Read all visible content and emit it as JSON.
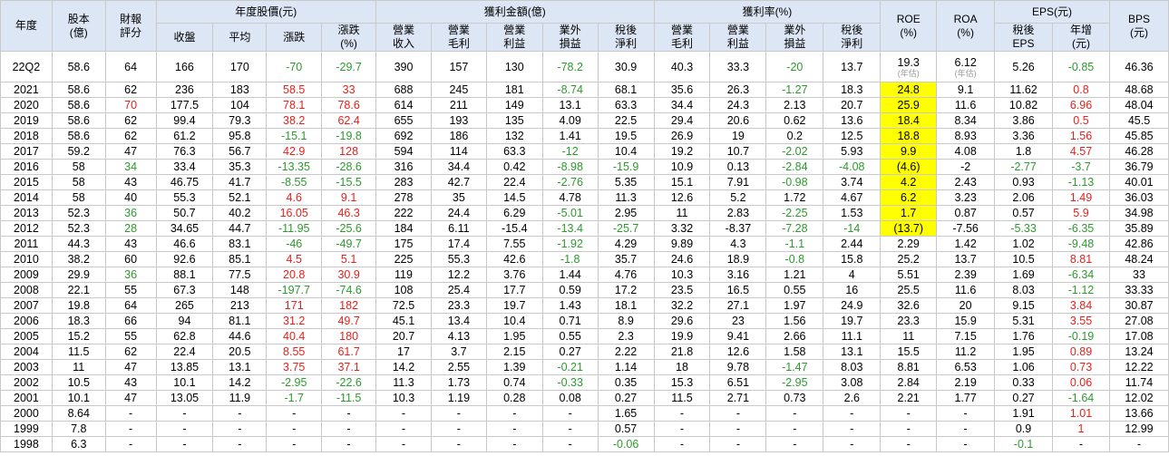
{
  "colors": {
    "header_bg": "#dce6f4",
    "border": "#c9c9c9",
    "positive": "#e8201a",
    "negative": "#2d9a2d",
    "highlight": "#ffff00"
  },
  "headers": {
    "year": "年度",
    "capital": "股本\n(億)",
    "rating": "財報\n評分",
    "price_group": "年度股價(元)",
    "price_close": "收盤",
    "price_avg": "平均",
    "price_chg": "漲跌",
    "price_chg_pct": "漲跌\n(%)",
    "amount_group": "獲利金額(億)",
    "amt_rev": "營業\n收入",
    "amt_gross": "營業\n毛利",
    "amt_op": "營業\n利益",
    "amt_nonop": "業外\n損益",
    "amt_net": "稅後\n淨利",
    "margin_group": "獲利率(%)",
    "mg_gross": "營業\n毛利",
    "mg_op": "營業\n利益",
    "mg_nonop": "業外\n損益",
    "mg_net": "稅後\n淨利",
    "roe": "ROE\n(%)",
    "roa": "ROA\n(%)",
    "eps_group": "EPS(元)",
    "eps": "稅後\nEPS",
    "eps_yoy": "年增\n(元)",
    "bps": "BPS\n(元)"
  },
  "rows": [
    {
      "year": "22Q2",
      "capital": "58.6",
      "rating": "64",
      "close": "166",
      "avg": "170",
      "chg": "-70",
      "chg_pct": "-29.7",
      "rev": "390",
      "gross": "157",
      "op": "130",
      "nonop": "-78.2",
      "net": "30.9",
      "mg_gross": "40.3",
      "mg_op": "33.3",
      "mg_nonop": "-20",
      "mg_net": "13.7",
      "roe": "19.3",
      "roe_note": "(年估)",
      "roa": "6.12",
      "roa_note": "(年估)",
      "eps": "5.26",
      "eps_yoy": "-0.85",
      "bps": "46.36"
    },
    {
      "year": "2021",
      "capital": "58.6",
      "rating": "62",
      "close": "236",
      "avg": "183",
      "chg": "58.5",
      "chg_pct": "33",
      "rev": "688",
      "gross": "245",
      "op": "181",
      "nonop": "-8.74",
      "net": "68.1",
      "mg_gross": "35.6",
      "mg_op": "26.3",
      "mg_nonop": "-1.27",
      "mg_net": "18.3",
      "roe": "24.8",
      "roa": "9.1",
      "eps": "11.62",
      "eps_yoy": "0.8",
      "bps": "48.68"
    },
    {
      "year": "2020",
      "capital": "58.6",
      "rating": "70",
      "close": "177.5",
      "avg": "104",
      "chg": "78.1",
      "chg_pct": "78.6",
      "rev": "614",
      "gross": "211",
      "op": "149",
      "nonop": "13.1",
      "net": "63.3",
      "mg_gross": "34.4",
      "mg_op": "24.3",
      "mg_nonop": "2.13",
      "mg_net": "20.7",
      "roe": "25.9",
      "roa": "11.6",
      "eps": "10.82",
      "eps_yoy": "6.96",
      "bps": "48.04"
    },
    {
      "year": "2019",
      "capital": "58.6",
      "rating": "62",
      "close": "99.4",
      "avg": "79.3",
      "chg": "38.2",
      "chg_pct": "62.4",
      "rev": "655",
      "gross": "193",
      "op": "135",
      "nonop": "4.09",
      "net": "22.5",
      "mg_gross": "29.4",
      "mg_op": "20.6",
      "mg_nonop": "0.62",
      "mg_net": "13.6",
      "roe": "18.4",
      "roa": "8.34",
      "eps": "3.86",
      "eps_yoy": "0.5",
      "bps": "45.5"
    },
    {
      "year": "2018",
      "capital": "58.6",
      "rating": "62",
      "close": "61.2",
      "avg": "95.8",
      "chg": "-15.1",
      "chg_pct": "-19.8",
      "rev": "692",
      "gross": "186",
      "op": "132",
      "nonop": "1.41",
      "net": "19.5",
      "mg_gross": "26.9",
      "mg_op": "19",
      "mg_nonop": "0.2",
      "mg_net": "12.5",
      "roe": "18.8",
      "roa": "8.93",
      "eps": "3.36",
      "eps_yoy": "1.56",
      "bps": "45.85"
    },
    {
      "year": "2017",
      "capital": "59.2",
      "rating": "47",
      "close": "76.3",
      "avg": "56.7",
      "chg": "42.9",
      "chg_pct": "128",
      "rev": "594",
      "gross": "114",
      "op": "63.3",
      "nonop": "-12",
      "net": "10.4",
      "mg_gross": "19.2",
      "mg_op": "10.7",
      "mg_nonop": "-2.02",
      "mg_net": "5.93",
      "roe": "9.9",
      "roa": "4.08",
      "eps": "1.8",
      "eps_yoy": "4.57",
      "bps": "46.28"
    },
    {
      "year": "2016",
      "capital": "58",
      "rating": "34",
      "close": "33.4",
      "avg": "35.3",
      "chg": "-13.35",
      "chg_pct": "-28.6",
      "rev": "316",
      "gross": "34.4",
      "op": "0.42",
      "nonop": "-8.98",
      "net": "-15.9",
      "mg_gross": "10.9",
      "mg_op": "0.13",
      "mg_nonop": "-2.84",
      "mg_net": "-4.08",
      "roe": "(4.6)",
      "roa": "-2",
      "eps": "-2.77",
      "eps_yoy": "-3.7",
      "bps": "36.79"
    },
    {
      "year": "2015",
      "capital": "58",
      "rating": "43",
      "close": "46.75",
      "avg": "41.7",
      "chg": "-8.55",
      "chg_pct": "-15.5",
      "rev": "283",
      "gross": "42.7",
      "op": "22.4",
      "nonop": "-2.76",
      "net": "5.35",
      "mg_gross": "15.1",
      "mg_op": "7.91",
      "mg_nonop": "-0.98",
      "mg_net": "3.74",
      "roe": "4.2",
      "roa": "2.43",
      "eps": "0.93",
      "eps_yoy": "-1.13",
      "bps": "40.01"
    },
    {
      "year": "2014",
      "capital": "58",
      "rating": "40",
      "close": "55.3",
      "avg": "52.1",
      "chg": "4.6",
      "chg_pct": "9.1",
      "rev": "278",
      "gross": "35",
      "op": "14.5",
      "nonop": "4.78",
      "net": "11.3",
      "mg_gross": "12.6",
      "mg_op": "5.2",
      "mg_nonop": "1.72",
      "mg_net": "4.67",
      "roe": "6.2",
      "roa": "3.23",
      "eps": "2.06",
      "eps_yoy": "1.49",
      "bps": "36.03"
    },
    {
      "year": "2013",
      "capital": "52.3",
      "rating": "36",
      "close": "50.7",
      "avg": "40.2",
      "chg": "16.05",
      "chg_pct": "46.3",
      "rev": "222",
      "gross": "24.4",
      "op": "6.29",
      "nonop": "-5.01",
      "net": "2.95",
      "mg_gross": "11",
      "mg_op": "2.83",
      "mg_nonop": "-2.25",
      "mg_net": "1.53",
      "roe": "1.7",
      "roa": "0.87",
      "eps": "0.57",
      "eps_yoy": "5.9",
      "bps": "34.98"
    },
    {
      "year": "2012",
      "capital": "52.3",
      "rating": "28",
      "close": "34.65",
      "avg": "44.7",
      "chg": "-11.95",
      "chg_pct": "-25.6",
      "rev": "184",
      "gross": "6.11",
      "op": "-15.4",
      "nonop": "-13.4",
      "net": "-25.7",
      "mg_gross": "3.32",
      "mg_op": "-8.37",
      "mg_nonop": "-7.28",
      "mg_net": "-14",
      "roe": "(13.7)",
      "roa": "-7.56",
      "eps": "-5.33",
      "eps_yoy": "-6.35",
      "bps": "35.89"
    },
    {
      "year": "2011",
      "capital": "44.3",
      "rating": "43",
      "close": "46.6",
      "avg": "83.1",
      "chg": "-46",
      "chg_pct": "-49.7",
      "rev": "175",
      "gross": "17.4",
      "op": "7.55",
      "nonop": "-1.92",
      "net": "4.29",
      "mg_gross": "9.89",
      "mg_op": "4.3",
      "mg_nonop": "-1.1",
      "mg_net": "2.44",
      "roe": "2.29",
      "roa": "1.42",
      "eps": "1.02",
      "eps_yoy": "-9.48",
      "bps": "42.86"
    },
    {
      "year": "2010",
      "capital": "38.2",
      "rating": "60",
      "close": "92.6",
      "avg": "85.1",
      "chg": "4.5",
      "chg_pct": "5.1",
      "rev": "225",
      "gross": "55.3",
      "op": "42.6",
      "nonop": "-1.8",
      "net": "35.7",
      "mg_gross": "24.6",
      "mg_op": "18.9",
      "mg_nonop": "-0.8",
      "mg_net": "15.8",
      "roe": "25.2",
      "roa": "13.7",
      "eps": "10.5",
      "eps_yoy": "8.81",
      "bps": "48.24"
    },
    {
      "year": "2009",
      "capital": "29.9",
      "rating": "36",
      "close": "88.1",
      "avg": "77.5",
      "chg": "20.8",
      "chg_pct": "30.9",
      "rev": "119",
      "gross": "12.2",
      "op": "3.76",
      "nonop": "1.44",
      "net": "4.76",
      "mg_gross": "10.3",
      "mg_op": "3.16",
      "mg_nonop": "1.21",
      "mg_net": "4",
      "roe": "5.51",
      "roa": "2.39",
      "eps": "1.69",
      "eps_yoy": "-6.34",
      "bps": "33"
    },
    {
      "year": "2008",
      "capital": "22.1",
      "rating": "55",
      "close": "67.3",
      "avg": "148",
      "chg": "-197.7",
      "chg_pct": "-74.6",
      "rev": "108",
      "gross": "25.4",
      "op": "17.7",
      "nonop": "0.59",
      "net": "17.2",
      "mg_gross": "23.5",
      "mg_op": "16.5",
      "mg_nonop": "0.55",
      "mg_net": "16",
      "roe": "25.5",
      "roa": "11.6",
      "eps": "8.03",
      "eps_yoy": "-1.12",
      "bps": "33.33"
    },
    {
      "year": "2007",
      "capital": "19.8",
      "rating": "64",
      "close": "265",
      "avg": "213",
      "chg": "171",
      "chg_pct": "182",
      "rev": "72.5",
      "gross": "23.3",
      "op": "19.7",
      "nonop": "1.43",
      "net": "18.1",
      "mg_gross": "32.2",
      "mg_op": "27.1",
      "mg_nonop": "1.97",
      "mg_net": "24.9",
      "roe": "32.6",
      "roa": "20",
      "eps": "9.15",
      "eps_yoy": "3.84",
      "bps": "30.87"
    },
    {
      "year": "2006",
      "capital": "18.3",
      "rating": "66",
      "close": "94",
      "avg": "81.1",
      "chg": "31.2",
      "chg_pct": "49.7",
      "rev": "45.1",
      "gross": "13.4",
      "op": "10.4",
      "nonop": "0.71",
      "net": "8.9",
      "mg_gross": "29.6",
      "mg_op": "23",
      "mg_nonop": "1.56",
      "mg_net": "19.7",
      "roe": "23.3",
      "roa": "15.9",
      "eps": "5.31",
      "eps_yoy": "3.55",
      "bps": "27.08"
    },
    {
      "year": "2005",
      "capital": "15.2",
      "rating": "55",
      "close": "62.8",
      "avg": "44.6",
      "chg": "40.4",
      "chg_pct": "180",
      "rev": "20.7",
      "gross": "4.13",
      "op": "1.95",
      "nonop": "0.55",
      "net": "2.3",
      "mg_gross": "19.9",
      "mg_op": "9.41",
      "mg_nonop": "2.66",
      "mg_net": "11.1",
      "roe": "11",
      "roa": "7.15",
      "eps": "1.76",
      "eps_yoy": "-0.19",
      "bps": "17.08"
    },
    {
      "year": "2004",
      "capital": "11.5",
      "rating": "62",
      "close": "22.4",
      "avg": "20.5",
      "chg": "8.55",
      "chg_pct": "61.7",
      "rev": "17",
      "gross": "3.7",
      "op": "2.15",
      "nonop": "0.27",
      "net": "2.22",
      "mg_gross": "21.8",
      "mg_op": "12.6",
      "mg_nonop": "1.58",
      "mg_net": "13.1",
      "roe": "15.5",
      "roa": "11.2",
      "eps": "1.95",
      "eps_yoy": "0.89",
      "bps": "13.24"
    },
    {
      "year": "2003",
      "capital": "11",
      "rating": "47",
      "close": "13.85",
      "avg": "13.1",
      "chg": "3.75",
      "chg_pct": "37.1",
      "rev": "14.2",
      "gross": "2.55",
      "op": "1.39",
      "nonop": "-0.21",
      "net": "1.14",
      "mg_gross": "18",
      "mg_op": "9.78",
      "mg_nonop": "-1.47",
      "mg_net": "8.03",
      "roe": "8.81",
      "roa": "6.53",
      "eps": "1.06",
      "eps_yoy": "0.73",
      "bps": "12.22"
    },
    {
      "year": "2002",
      "capital": "10.5",
      "rating": "43",
      "close": "10.1",
      "avg": "14.2",
      "chg": "-2.95",
      "chg_pct": "-22.6",
      "rev": "11.3",
      "gross": "1.73",
      "op": "0.74",
      "nonop": "-0.33",
      "net": "0.35",
      "mg_gross": "15.3",
      "mg_op": "6.51",
      "mg_nonop": "-2.95",
      "mg_net": "3.08",
      "roe": "2.84",
      "roa": "2.19",
      "eps": "0.33",
      "eps_yoy": "0.06",
      "bps": "11.74"
    },
    {
      "year": "2001",
      "capital": "10.1",
      "rating": "47",
      "close": "13.05",
      "avg": "11.9",
      "chg": "-1.7",
      "chg_pct": "-11.5",
      "rev": "10.3",
      "gross": "1.19",
      "op": "0.28",
      "nonop": "0.08",
      "net": "0.27",
      "mg_gross": "11.5",
      "mg_op": "2.71",
      "mg_nonop": "0.73",
      "mg_net": "2.6",
      "roe": "2.21",
      "roa": "1.77",
      "eps": "0.27",
      "eps_yoy": "-1.64",
      "bps": "12.02"
    },
    {
      "year": "2000",
      "capital": "8.64",
      "rating": "-",
      "close": "-",
      "avg": "-",
      "chg": "-",
      "chg_pct": "-",
      "rev": "-",
      "gross": "-",
      "op": "-",
      "nonop": "-",
      "net": "1.65",
      "mg_gross": "-",
      "mg_op": "-",
      "mg_nonop": "-",
      "mg_net": "-",
      "roe": "-",
      "roa": "-",
      "eps": "1.91",
      "eps_yoy": "1.01",
      "bps": "13.66"
    },
    {
      "year": "1999",
      "capital": "7.8",
      "rating": "-",
      "close": "-",
      "avg": "-",
      "chg": "-",
      "chg_pct": "-",
      "rev": "-",
      "gross": "-",
      "op": "-",
      "nonop": "-",
      "net": "0.57",
      "mg_gross": "-",
      "mg_op": "-",
      "mg_nonop": "-",
      "mg_net": "-",
      "roe": "-",
      "roa": "-",
      "eps": "0.9",
      "eps_yoy": "1",
      "bps": "12.99"
    },
    {
      "year": "1998",
      "capital": "6.3",
      "rating": "-",
      "close": "-",
      "avg": "-",
      "chg": "-",
      "chg_pct": "-",
      "rev": "-",
      "gross": "-",
      "op": "-",
      "nonop": "-",
      "net": "-0.06",
      "mg_gross": "-",
      "mg_op": "-",
      "mg_nonop": "-",
      "mg_net": "-",
      "roe": "-",
      "roa": "-",
      "eps": "-0.1",
      "eps_yoy": "-",
      "bps": "-"
    }
  ]
}
